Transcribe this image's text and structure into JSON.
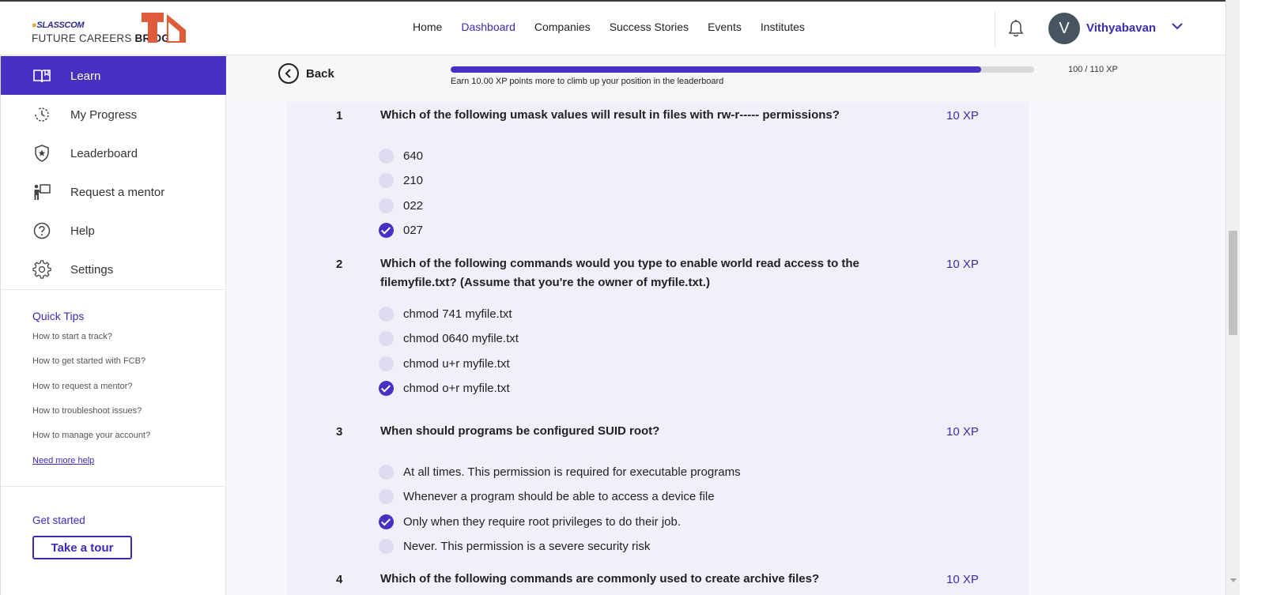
{
  "header": {
    "logo_tag": "SLASSCOM",
    "logo_name_light": "FUTURE CAREERS ",
    "logo_name_bold": "BRIDGE",
    "nav": [
      {
        "label": "Home",
        "active": false
      },
      {
        "label": "Dashboard",
        "active": true
      },
      {
        "label": "Companies",
        "active": false
      },
      {
        "label": "Success Stories",
        "active": false
      },
      {
        "label": "Events",
        "active": false
      },
      {
        "label": "Institutes",
        "active": false
      }
    ],
    "avatar_initial": "V",
    "user_name": "Vithyabavan"
  },
  "sidebar": {
    "items": [
      {
        "label": "Learn",
        "icon": "book-icon",
        "active": true
      },
      {
        "label": "My Progress",
        "icon": "history-icon",
        "active": false
      },
      {
        "label": "Leaderboard",
        "icon": "shield-star-icon",
        "active": false
      },
      {
        "label": "Request a mentor",
        "icon": "mentor-board-icon",
        "active": false
      },
      {
        "label": "Help",
        "icon": "question-circle-icon",
        "active": false
      },
      {
        "label": "Settings",
        "icon": "gear-icon",
        "active": false
      }
    ],
    "quick_tips_title": "Quick Tips",
    "quick_tips": [
      "How to start a track?",
      "How to get started with FCB?",
      "How to request a mentor?",
      "How to troubleshoot issues?",
      "How to manage your account?"
    ],
    "need_more_help": "Need more help",
    "get_started_title": "Get started",
    "tour_button": "Take a tour"
  },
  "progress": {
    "back_label": "Back",
    "fraction": 0.909,
    "caption": "Earn 10.00 XP points more to climb up your position in the leaderboard",
    "xp_count": "100 / 110 XP"
  },
  "questions": [
    {
      "number": "1",
      "text": "Which of the following umask values will result in files with rw-r----- permissions?",
      "xp": "10 XP",
      "options": [
        {
          "text": "640",
          "checked": false
        },
        {
          "text": "210",
          "checked": false
        },
        {
          "text": "022",
          "checked": false
        },
        {
          "text": "027",
          "checked": true
        }
      ]
    },
    {
      "number": "2",
      "text": "Which of the following commands would you type to enable world read access to the filemyfile.txt? (Assume that you're the owner of myfile.txt.)",
      "xp": "10 XP",
      "options": [
        {
          "text": "chmod 741 myfile.txt",
          "checked": false
        },
        {
          "text": "chmod 0640 myfile.txt",
          "checked": false
        },
        {
          "text": "chmod u+r myfile.txt",
          "checked": false
        },
        {
          "text": "chmod o+r myfile.txt",
          "checked": true
        }
      ]
    },
    {
      "number": "3",
      "text": "When should programs be configured SUID root?",
      "xp": "10 XP",
      "options": [
        {
          "text": "At all times. This permission is required for executable programs",
          "checked": false
        },
        {
          "text": "Whenever a program should be able to access a device file",
          "checked": false
        },
        {
          "text": "Only when they require root privileges to do their job.",
          "checked": true
        },
        {
          "text": "Never. This permission is a severe security risk",
          "checked": false
        }
      ]
    },
    {
      "number": "4",
      "text": "Which of the following commands are commonly used to create archive files?",
      "xp": "10 XP",
      "options": []
    }
  ],
  "colors": {
    "accent": "#4a30c2",
    "link": "#3b2bb3",
    "panel_bg": "#f1f0fa",
    "radio_unchecked": "#dedbf1"
  }
}
